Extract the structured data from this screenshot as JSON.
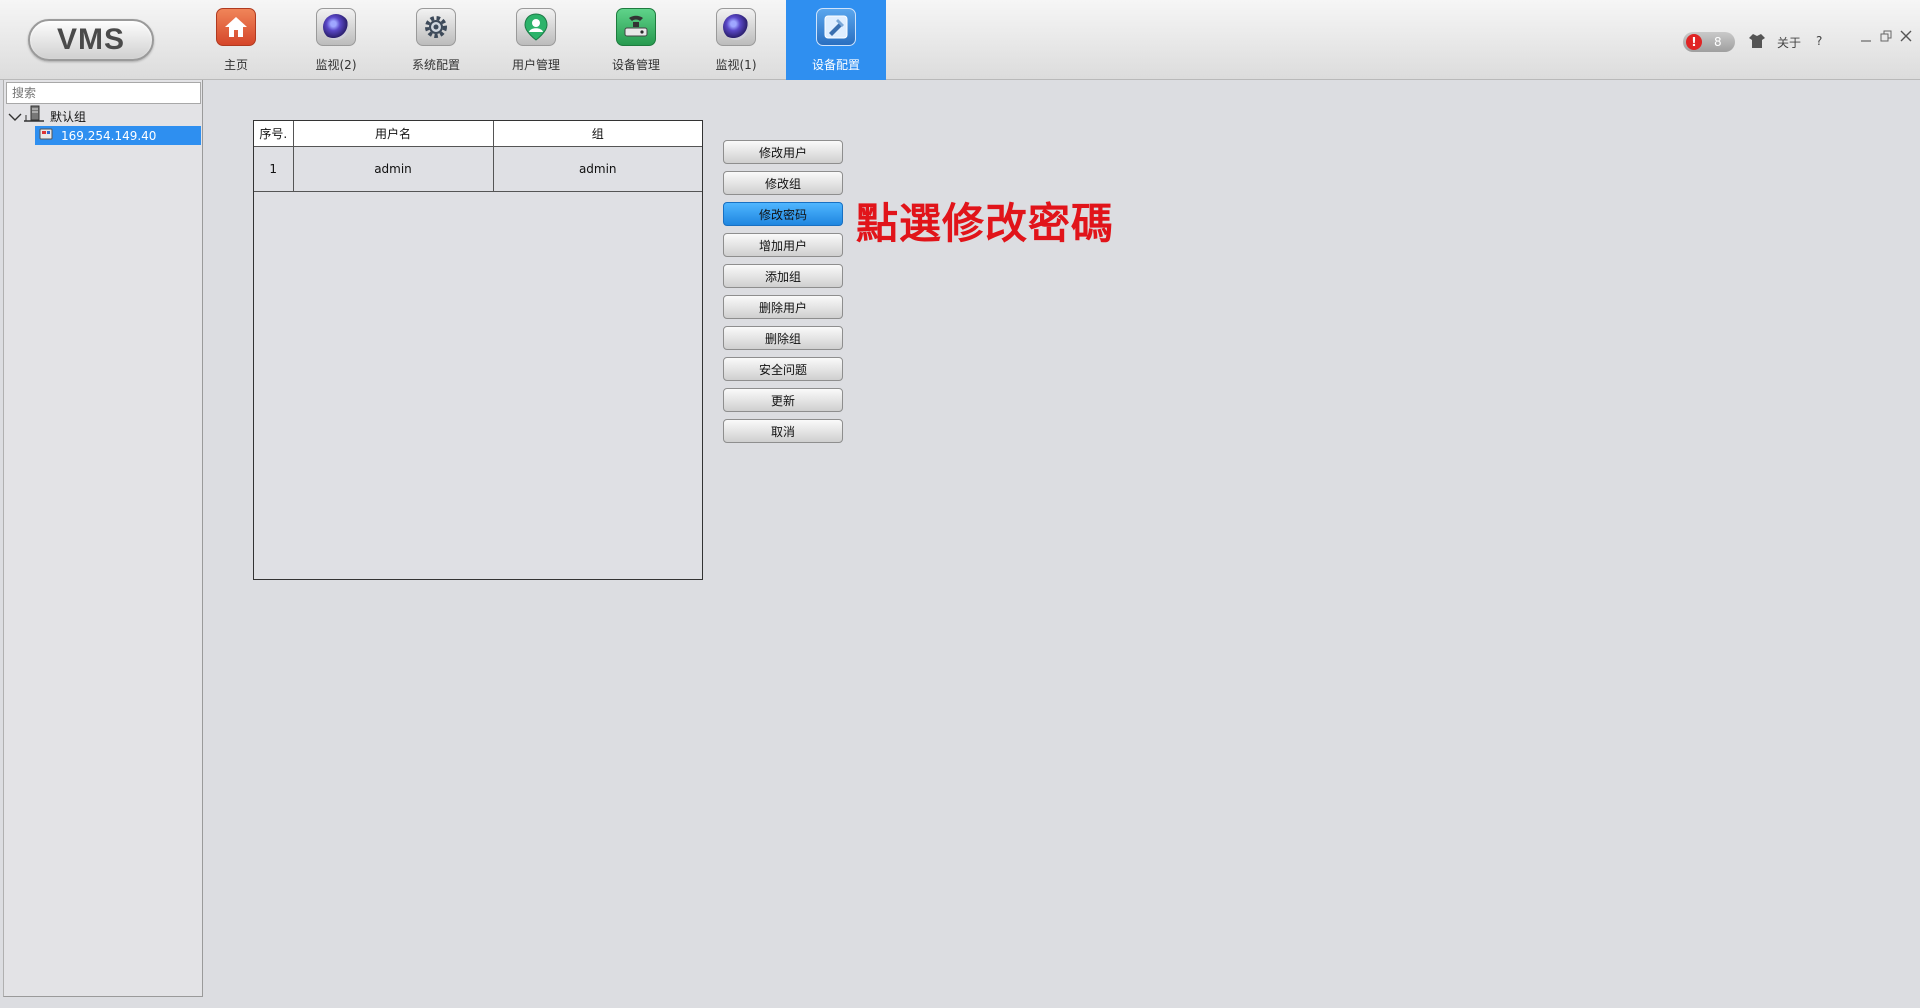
{
  "app": {
    "logo": "VMS"
  },
  "nav": [
    {
      "label": "主页",
      "icon": "home-icon"
    },
    {
      "label": "监视(2)",
      "icon": "camera-lens-icon"
    },
    {
      "label": "系统配置",
      "icon": "gear-icon"
    },
    {
      "label": "用户管理",
      "icon": "user-icon"
    },
    {
      "label": "设备管理",
      "icon": "device-icon"
    },
    {
      "label": "监视(1)",
      "icon": "camera-lens-icon"
    },
    {
      "label": "设备配置",
      "icon": "device-config-icon",
      "active": true
    }
  ],
  "topright": {
    "alert_count": "8",
    "alert_symbol": "!",
    "about": "关于",
    "help": "?"
  },
  "sidebar": {
    "search_placeholder": "搜索",
    "group": "默认组",
    "device": "169.254.149.40"
  },
  "user_table": {
    "headers": [
      "序号.",
      "用户名",
      "组"
    ],
    "rows": [
      [
        "1",
        "admin",
        "admin"
      ]
    ]
  },
  "buttons": [
    "修改用户",
    "修改组",
    "修改密码",
    "增加用户",
    "添加组",
    "删除用户",
    "删除组",
    "安全问题",
    "更新",
    "取消"
  ],
  "annotation": "點選修改密碼",
  "colors": {
    "accent": "#2f8ff0",
    "annotation": "#e1141a",
    "alert": "#e02424"
  }
}
